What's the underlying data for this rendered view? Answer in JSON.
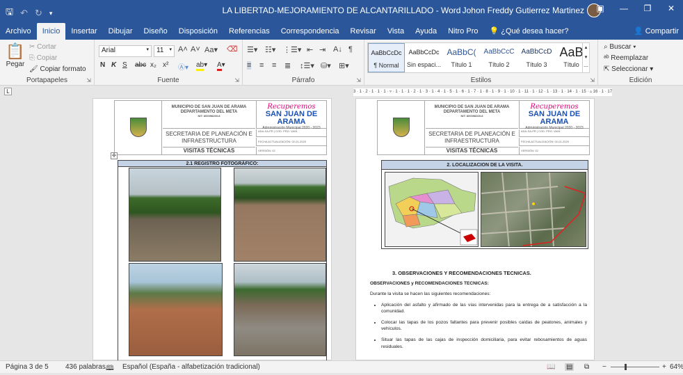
{
  "window": {
    "title": "LA LIBERTAD-MEJORAMIENTO DE ALCANTARILLADO - Word",
    "user": "Johon Freddy Gutierrez Martinez",
    "qat_icons": [
      "save-icon",
      "undo-icon",
      "redo-icon",
      "customize-icon"
    ],
    "controls": [
      "ribbon-display-icon",
      "minimize-icon",
      "restore-icon",
      "close-icon"
    ]
  },
  "menu": {
    "tabs": [
      "Archivo",
      "Inicio",
      "Insertar",
      "Dibujar",
      "Diseño",
      "Disposición",
      "Referencias",
      "Correspondencia",
      "Revisar",
      "Vista",
      "Ayuda",
      "Nitro Pro"
    ],
    "active": "Inicio",
    "tell_me": "¿Qué desea hacer?",
    "share": "Compartir"
  },
  "ribbon": {
    "clipboard": {
      "paste": "Pegar",
      "cut": "Cortar",
      "copy": "Copiar",
      "format_painter": "Copiar formato",
      "label": "Portapapeles"
    },
    "font": {
      "name": "Arial",
      "size": "11",
      "label": "Fuente"
    },
    "paragraph": {
      "label": "Párrafo"
    },
    "styles": {
      "label": "Estilos",
      "items": [
        {
          "sample": "AaBbCcDc",
          "name": "¶ Normal"
        },
        {
          "sample": "AaBbCcDc",
          "name": "Sin espaci..."
        },
        {
          "sample": "AaBbC(",
          "name": "Título 1"
        },
        {
          "sample": "AaBbCcC",
          "name": "Título 2"
        },
        {
          "sample": "AaBbCcD",
          "name": "Título 3"
        },
        {
          "sample": "AaB",
          "name": "Título"
        }
      ]
    },
    "editing": {
      "find": "Buscar",
      "replace": "Reemplazar",
      "select": "Seleccionar",
      "label": "Edición"
    }
  },
  "ruler": {
    "text": "3 · 1 · 2 · 1 · 1 · 1 · ▿ · 1 · 1 · 1 · 2 · 1 · 3 · 1 · 4 · 1 · 5 · 1 · 6 · 1 · 7 · 1 · 8 · 1 · 9 · 1 · 10 · 1 · 11 · 1 · 12 · 1 · 13 · 1 · 14 · 1 · 15 · ▵ 16 · 1 · 17 · 1 · 18 · 1"
  },
  "header": {
    "municipio": "MUNICIPIO DE SAN JUAN DE ARAMA",
    "departamento": "DEPARTAMENTO DEL META",
    "nit": "NIT: 800098269-8",
    "secretaria": "SECRETARIA DE PLANEACIÓN E INFRAESTRUCTURA",
    "visitas": "VISITAS TÉCNICAS",
    "brand_script": "Recuperemos",
    "brand_name": "SAN JUAN DE ARAMA",
    "brand_sub": "Administración Municipal 2020 - 2023",
    "meta1": "ADA-SA-PR | COD. PRO. VA04",
    "meta2": "FECHA ACTUALIZACIÓN: 02-01-2020",
    "meta3": "VERSIÓN: 02"
  },
  "left_page": {
    "section_title": "2.1      REGISTRO FOTOGRÁFICO:",
    "photos": [
      "photo-road-1",
      "photo-road-2",
      "photo-yard-tires",
      "photo-flooded-road"
    ]
  },
  "right_page": {
    "section_title": "2.  LOCALIZACION DE LA VISITA.",
    "obs_title": "3.  OBSERVACIONES Y RECOMENDACIONES TECNICAS.",
    "obs_sub": "OBSERVACIONES y RECOMENDACIONES TECNICAS:",
    "obs_intro": "Durante la visita se hacen las siguientes recomendaciones:",
    "bullets": [
      "Aplicación del asfalto y afirmado de las vías intervenidas para la entrega de a satisfacción a la comunidad.",
      "Colocar las tapas de los pozos faltantes para prevenir posibles caídas de peatones, animales y vehículos.",
      "Situar las tapas de las cajas de inspección domiciliaria, para evitar rebosamientos de aguas residuales."
    ]
  },
  "status": {
    "page": "Página 3 de 5",
    "words": "436 palabras",
    "language": "Español (España - alfabetización tradicional)",
    "zoom": "64%",
    "zoom_value": 0.64
  },
  "colors": {
    "brand": "#2b579a",
    "table_header": "#c5d3e6"
  }
}
